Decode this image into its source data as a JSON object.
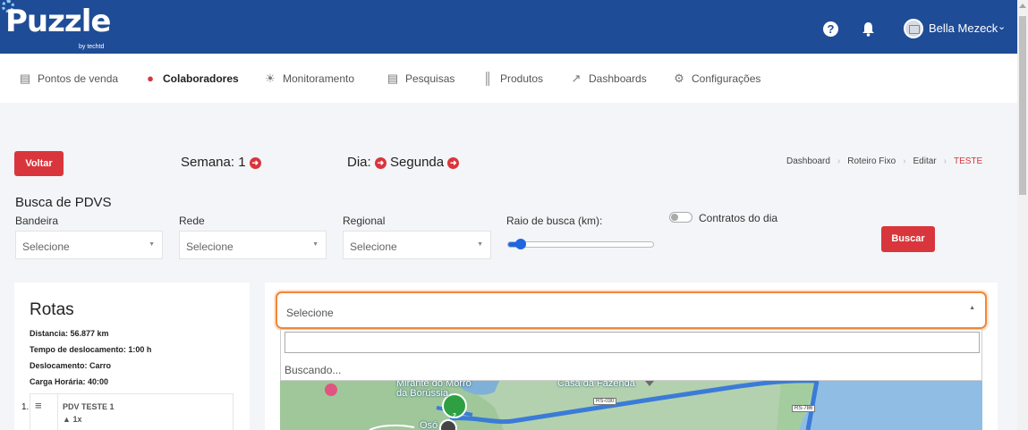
{
  "header": {
    "logo_text": "Puzzle",
    "logo_sub": "by techtd",
    "user_name": "Bella Mezeck",
    "icons": [
      "help-icon",
      "bell-icon",
      "avatar",
      "chevron-down-icon"
    ]
  },
  "nav": {
    "items": [
      {
        "label": "Pontos de venda",
        "icon": "store-icon"
      },
      {
        "label": "Colaboradores",
        "icon": "users-icon"
      },
      {
        "label": "Monitoramento",
        "icon": "monitor-icon"
      },
      {
        "label": "Pesquisas",
        "icon": "survey-icon"
      },
      {
        "label": "Produtos",
        "icon": "barcode-icon"
      },
      {
        "label": "Dashboards",
        "icon": "chart-icon"
      },
      {
        "label": "Configurações",
        "icon": "cogs-icon"
      }
    ],
    "active": "Colaboradores"
  },
  "toolbar": {
    "back_label": "Voltar",
    "week_label": "Semana: 1",
    "day_label": "Dia:",
    "day_value": "Segunda"
  },
  "breadcrumb": [
    "Dashboard",
    "Roteiro Fixo",
    "Editar",
    "TESTE"
  ],
  "busca": {
    "title": "Busca de PDVS",
    "fields": [
      {
        "label": "Bandeira",
        "value": "Selecione"
      },
      {
        "label": "Rede",
        "value": "Selecione"
      },
      {
        "label": "Regional",
        "value": "Selecione"
      }
    ],
    "raio_label": "Raio de busca (km):",
    "raio_value_fraction": 0.05,
    "contratos_label": "Contratos do dia",
    "contratos_on": false,
    "search_button": "Buscar"
  },
  "rotas": {
    "title": "Rotas",
    "distancia": "Distancia: 56.877 km",
    "tempo": "Tempo de deslocamento: 1:00 h",
    "deslocamento": "Deslocamento: Carro",
    "carga": "Carga Horária: 40:00",
    "items": [
      {
        "num": "1.",
        "name": "PDV TESTE 1",
        "freq": "1x"
      }
    ]
  },
  "map_select": {
    "value": "Selecione",
    "search_value": "",
    "status": "Buscando..."
  },
  "map": {
    "labels": [
      "Mirante do Morro",
      "da Borússia",
      "Casa da Fazenda",
      "Osó"
    ],
    "roads": [
      "RS-030",
      "RS-786"
    ],
    "marker_count": "2",
    "colors": {
      "accent": "#d8363c",
      "brand": "#1f4c96",
      "focus": "#f0873a"
    }
  }
}
